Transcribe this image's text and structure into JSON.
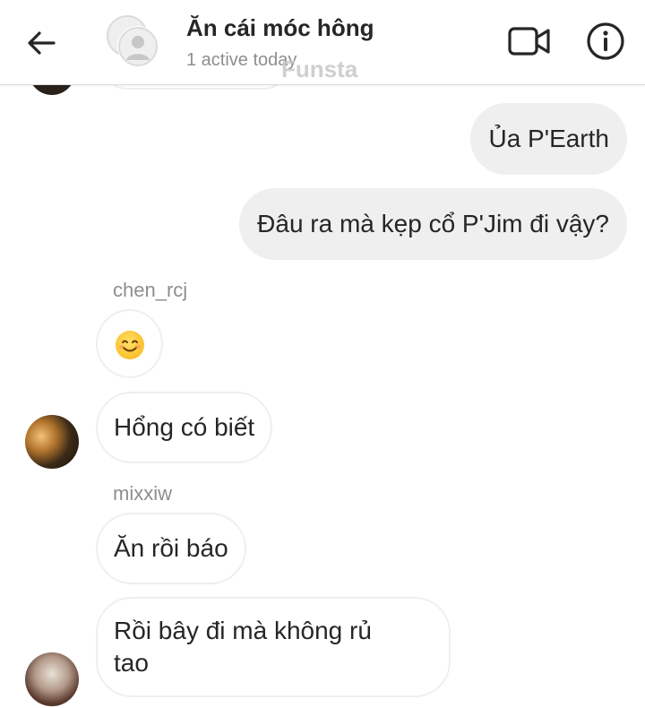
{
  "header": {
    "title": "Ăn cái móc hông",
    "status": "1 active today",
    "watermark": "Funsta"
  },
  "messages": [
    {
      "dir": "out",
      "text": "Ủa P'Earth"
    },
    {
      "dir": "out",
      "text": "Đâu ra mà kẹp cổ P'Jim đi vậy?"
    },
    {
      "dir": "in",
      "sender": "chen_rcj",
      "emoji": "smiling-face"
    },
    {
      "dir": "in",
      "text": "Hổng có biết"
    },
    {
      "dir": "in",
      "sender": "mixxiw",
      "text": "Ăn rồi báo"
    },
    {
      "dir": "in",
      "text_line1": "Rồi bây đi mà không rủ",
      "text_line2": "tao"
    }
  ],
  "colors": {
    "outgoing_bubble": "#efefef",
    "incoming_border": "#efefef",
    "secondary_text": "#8e8e8e",
    "primary_text": "#262626"
  }
}
